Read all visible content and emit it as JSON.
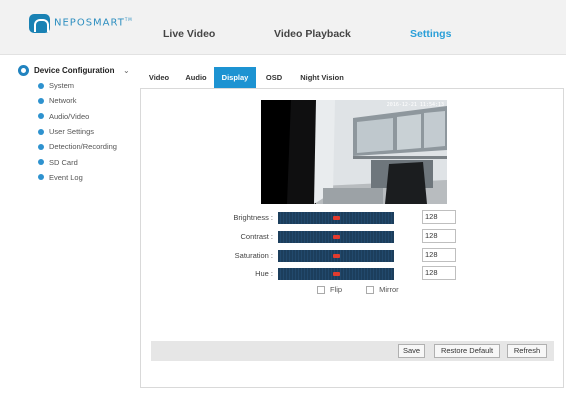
{
  "header": {
    "logo_text": "NEPOSMART",
    "logo_mark": "TM",
    "nav": [
      {
        "label": "Live Video",
        "active": false
      },
      {
        "label": "Video Playback",
        "active": false
      },
      {
        "label": "Settings",
        "active": true
      }
    ]
  },
  "sidebar": {
    "title": "Device Configuration",
    "caret": "⌄",
    "items": [
      {
        "label": "System"
      },
      {
        "label": "Network"
      },
      {
        "label": "Audio/Video"
      },
      {
        "label": "User Settings"
      },
      {
        "label": "Detection/Recording"
      },
      {
        "label": "SD Card"
      },
      {
        "label": "Event Log"
      }
    ]
  },
  "tabs": [
    {
      "label": "Video",
      "active": false
    },
    {
      "label": "Audio",
      "active": false
    },
    {
      "label": "Display",
      "active": true
    },
    {
      "label": "OSD",
      "active": false
    },
    {
      "label": "Night Vision",
      "active": false
    }
  ],
  "preview": {
    "timestamp": "2016-12-21 11:54:13"
  },
  "display": {
    "sliders": [
      {
        "label": "Brightness :",
        "value": "128",
        "level": 0.5
      },
      {
        "label": "Contrast :",
        "value": "128",
        "level": 0.5
      },
      {
        "label": "Saturation :",
        "value": "128",
        "level": 0.5
      },
      {
        "label": "Hue :",
        "value": "128",
        "level": 0.5
      }
    ],
    "flip_label": "Flip",
    "mirror_label": "Mirror",
    "flip_checked": false,
    "mirror_checked": false
  },
  "footer": {
    "save_label": "Save",
    "restore_label": "Restore Default",
    "refresh_label": "Refresh"
  },
  "colors": {
    "accent": "#1d93d2",
    "slider_track": "#1c3e5c",
    "slider_thumb": "#e33b2e"
  }
}
